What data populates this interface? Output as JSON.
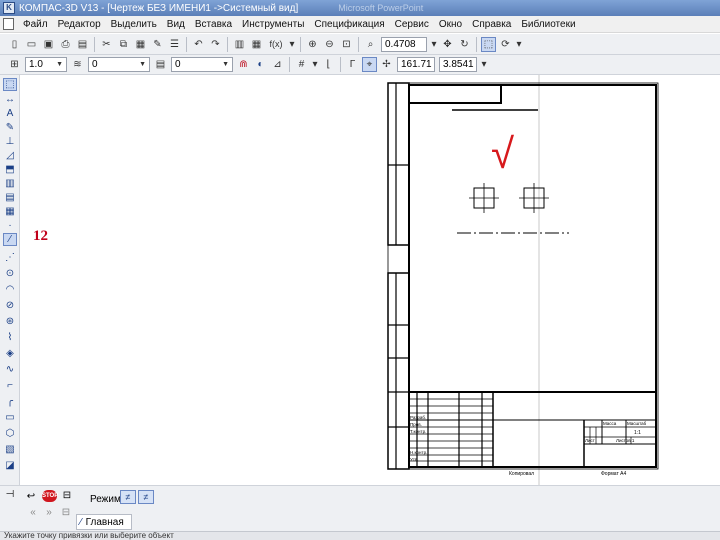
{
  "window": {
    "title": "КОМПАС-3D V13 - [Чертеж БЕЗ ИМЕНИ1 ->Системный вид]",
    "title_blur": "Microsoft PowerPoint"
  },
  "menu": [
    "Файл",
    "Редактор",
    "Выделить",
    "Вид",
    "Вставка",
    "Инструменты",
    "Спецификация",
    "Сервис",
    "Окно",
    "Справка",
    "Библиотеки"
  ],
  "toolbar1": {
    "zoom_value": "0.4708",
    "fx_label": "f(x)"
  },
  "toolbar2": {
    "step_value": "1.0",
    "layer_value": "0",
    "style_value": "0",
    "coord_x": "161.71",
    "coord_y": "3.8541"
  },
  "canvas": {
    "badge_number": "12"
  },
  "drawing": {
    "roughness_mark": "√",
    "title_block": {
      "labels": [
        "Разраб.",
        "Пров.",
        "Т.контр.",
        "Н.контр.",
        "Утв."
      ],
      "footer_left": "Копировал",
      "footer_right": "Формат А4",
      "sheet_label": "Лист",
      "sheets_label": "Листов 1",
      "mass_label": "Масса",
      "scale_label": "Масштаб",
      "scale_value": "1:1"
    }
  },
  "bottompanel": {
    "stop_label": "STOP",
    "mode_label": "Режим",
    "tab_label": "Главная"
  },
  "statusbar": {
    "text": "Укажите точку привязки или выберите объект"
  }
}
